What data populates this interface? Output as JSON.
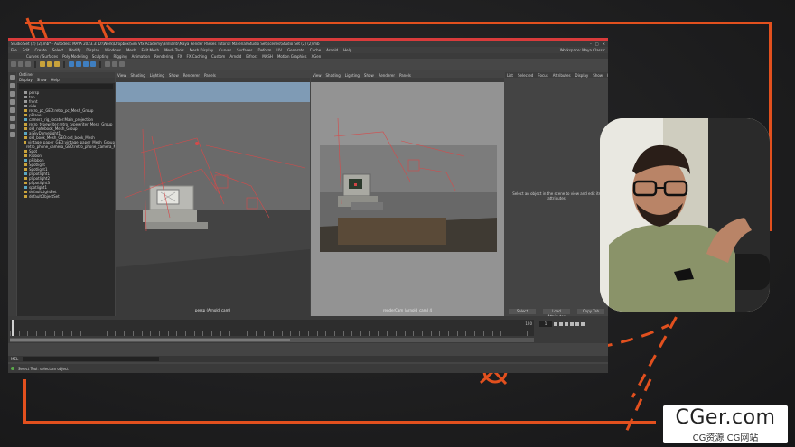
{
  "maya": {
    "title": "Studio Set (2) (2).mb* - Autodesk MAYA 2023.3: D:\\Work\\Dropbox\\Sim Vfx Academy\\Brillianti\\Maya Render Passes Tutorial Material\\Studio Set\\scenes\\Studio Set (2) (2).mb",
    "menu": [
      "File",
      "Edit",
      "Create",
      "Select",
      "Modify",
      "Display",
      "Windows",
      "Mesh",
      "Edit Mesh",
      "Mesh Tools",
      "Mesh Display",
      "Curves",
      "Surfaces",
      "Deform",
      "UV",
      "Generate",
      "Cache",
      "Arnold",
      "Help"
    ],
    "workspace": "Workspace: Maya Classic",
    "shelf_tabs": [
      "Curves / Surfaces",
      "Poly Modeling",
      "Sculpting",
      "Rigging",
      "Animation",
      "Rendering",
      "FX",
      "FX Caching",
      "Custom",
      "Arnold",
      "Bifrost",
      "MASH",
      "Motion Graphics",
      "XGen"
    ],
    "outliner": {
      "title": "Outliner",
      "menu": [
        "Display",
        "Show",
        "Help"
      ],
      "items": [
        "persp",
        "top",
        "front",
        "side",
        "retro_pc_GEO:retro_pc_Mesh_Group",
        "pPlane1",
        "camera_rig_locator:Main_projection",
        "retro_typewriter:retro_typewriter_Mesh_Group",
        "old_notebook_Mesh_Group",
        "aiSkyDomeLight1",
        "old_book_Mesh_GEO:old_book_Mesh",
        "vintage_paper_GEO:vintage_paper_Mesh_Group",
        "retro_phone_camera_GEO:retro_phone_camera_Mesh_Group",
        "Spot",
        "Ribbon",
        "pRibbon",
        "Spotlight",
        "Spotlight1",
        "pSpotlight1",
        "pSpotlight2",
        "pSpotlight3",
        "spotlight1",
        "defaultLightSet",
        "defaultObjectSet"
      ]
    },
    "viewport_menu": [
      "View",
      "Shading",
      "Lighting",
      "Show",
      "Renderer",
      "Panels"
    ],
    "persp_label": "persp (Arnold_cam)",
    "render_label": "renderCam (Arnold_cam) 4",
    "attr_tabs": [
      "List",
      "Selected",
      "Focus",
      "Attributes",
      "Display",
      "Show",
      "Help"
    ],
    "attr_message": "Select an object in the scene to view and edit its attributes",
    "attr_buttons": [
      "Select",
      "Load Attributes",
      "Copy Tab"
    ],
    "frame_start": "1",
    "frame_end": "120",
    "current_frame": "1",
    "cmd_label": "MEL",
    "help_text": "Select Tool: select an object"
  },
  "watermark": {
    "title": "CGer.com",
    "subtitle": "CG资源 CG网站"
  },
  "colors": {
    "accent": "#e2501e",
    "maya_title": "#d93b3b",
    "wire": "#d64a4a"
  }
}
